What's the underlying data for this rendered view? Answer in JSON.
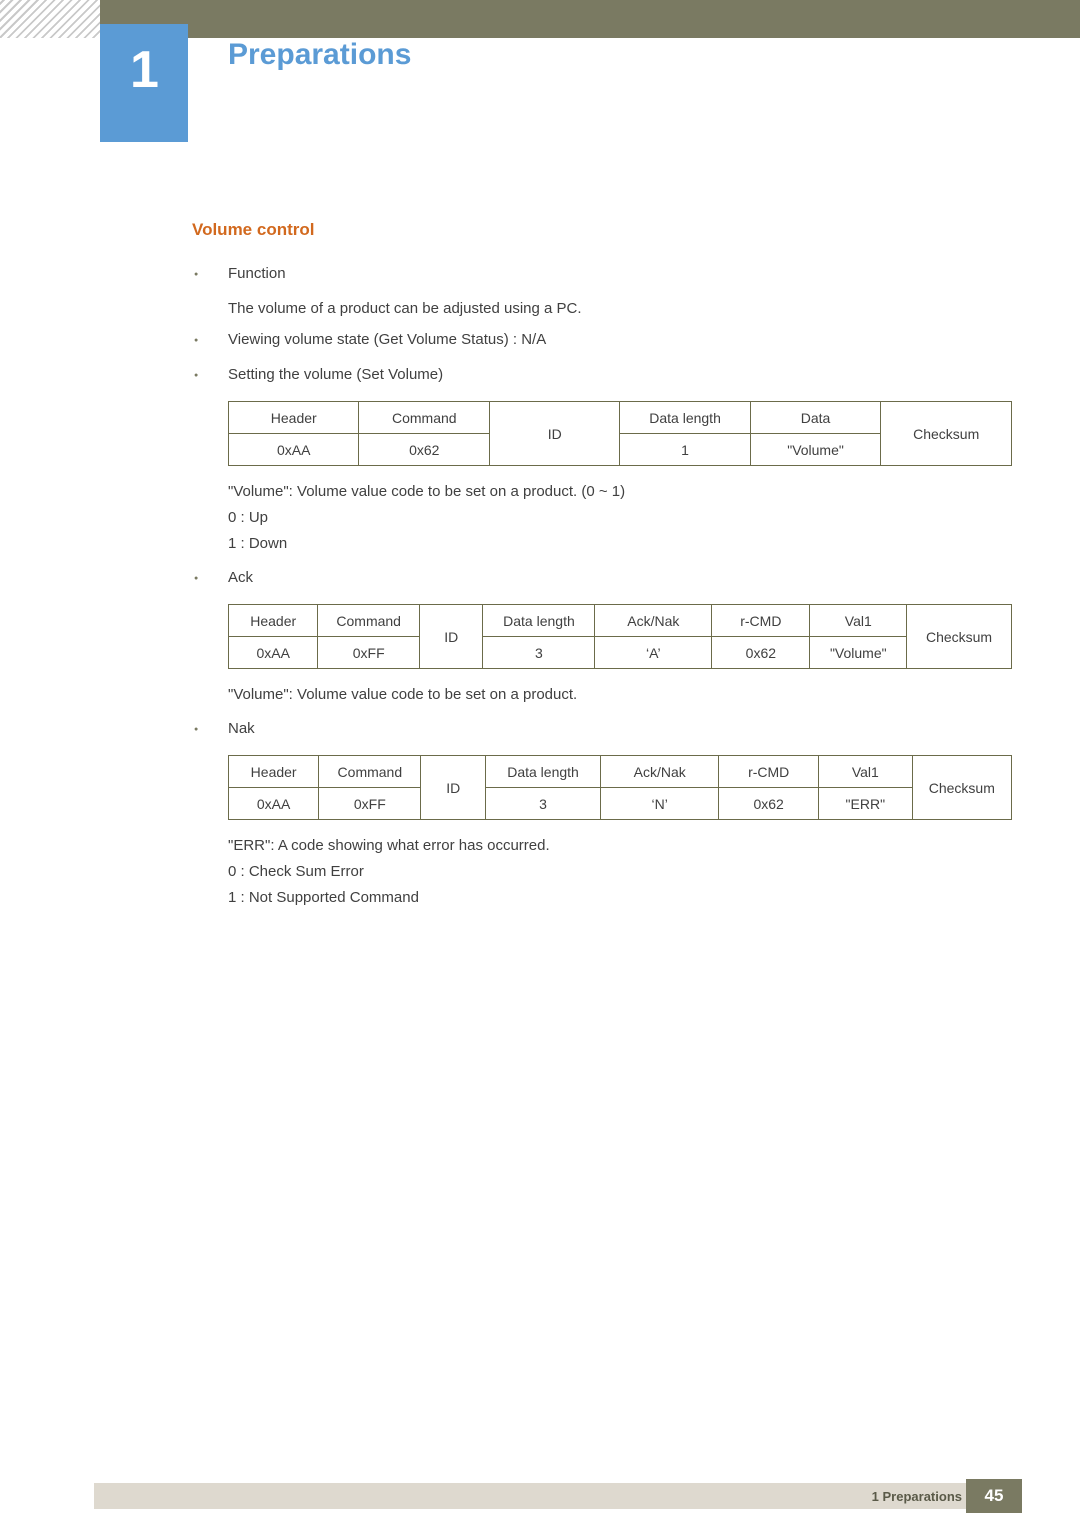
{
  "header": {
    "chapter_number": "1",
    "chapter_title": "Preparations"
  },
  "section": {
    "title": "Volume control"
  },
  "bullets": {
    "function_label": "Function",
    "function_desc": "The volume of a product can be adjusted using a PC.",
    "viewing_state": "Viewing volume state (Get Volume Status) : N/A",
    "setting_volume": "Setting the volume (Set Volume)",
    "ack_label": "Ack",
    "nak_label": "Nak"
  },
  "notes": {
    "volume_note_1": "\"Volume\": Volume value code to be set on a product. (0 ~ 1)",
    "volume_up": "0 : Up",
    "volume_down": "1 : Down",
    "volume_note_2": "\"Volume\": Volume value code to be set on a product.",
    "err_note": "\"ERR\": A code showing what error has occurred.",
    "err_0": "0 : Check Sum Error",
    "err_1": "1 : Not Supported Command"
  },
  "tables": {
    "set_volume": {
      "headers": [
        "Header",
        "Command",
        "ID",
        "Data length",
        "Data",
        "Checksum"
      ],
      "values": [
        "0xAA",
        "0x62",
        "1",
        "\"Volume\""
      ]
    },
    "ack": {
      "headers": [
        "Header",
        "Command",
        "ID",
        "Data length",
        "Ack/Nak",
        "r-CMD",
        "Val1",
        "Checksum"
      ],
      "values": [
        "0xAA",
        "0xFF",
        "3",
        "‘A’",
        "0x62",
        "\"Volume\""
      ]
    },
    "nak": {
      "headers": [
        "Header",
        "Command",
        "ID",
        "Data length",
        "Ack/Nak",
        "r-CMD",
        "Val1",
        "Checksum"
      ],
      "values": [
        "0xAA",
        "0xFF",
        "3",
        "‘N’",
        "0x62",
        "\"ERR\""
      ]
    }
  },
  "footer": {
    "label": "1 Preparations",
    "page": "45"
  }
}
